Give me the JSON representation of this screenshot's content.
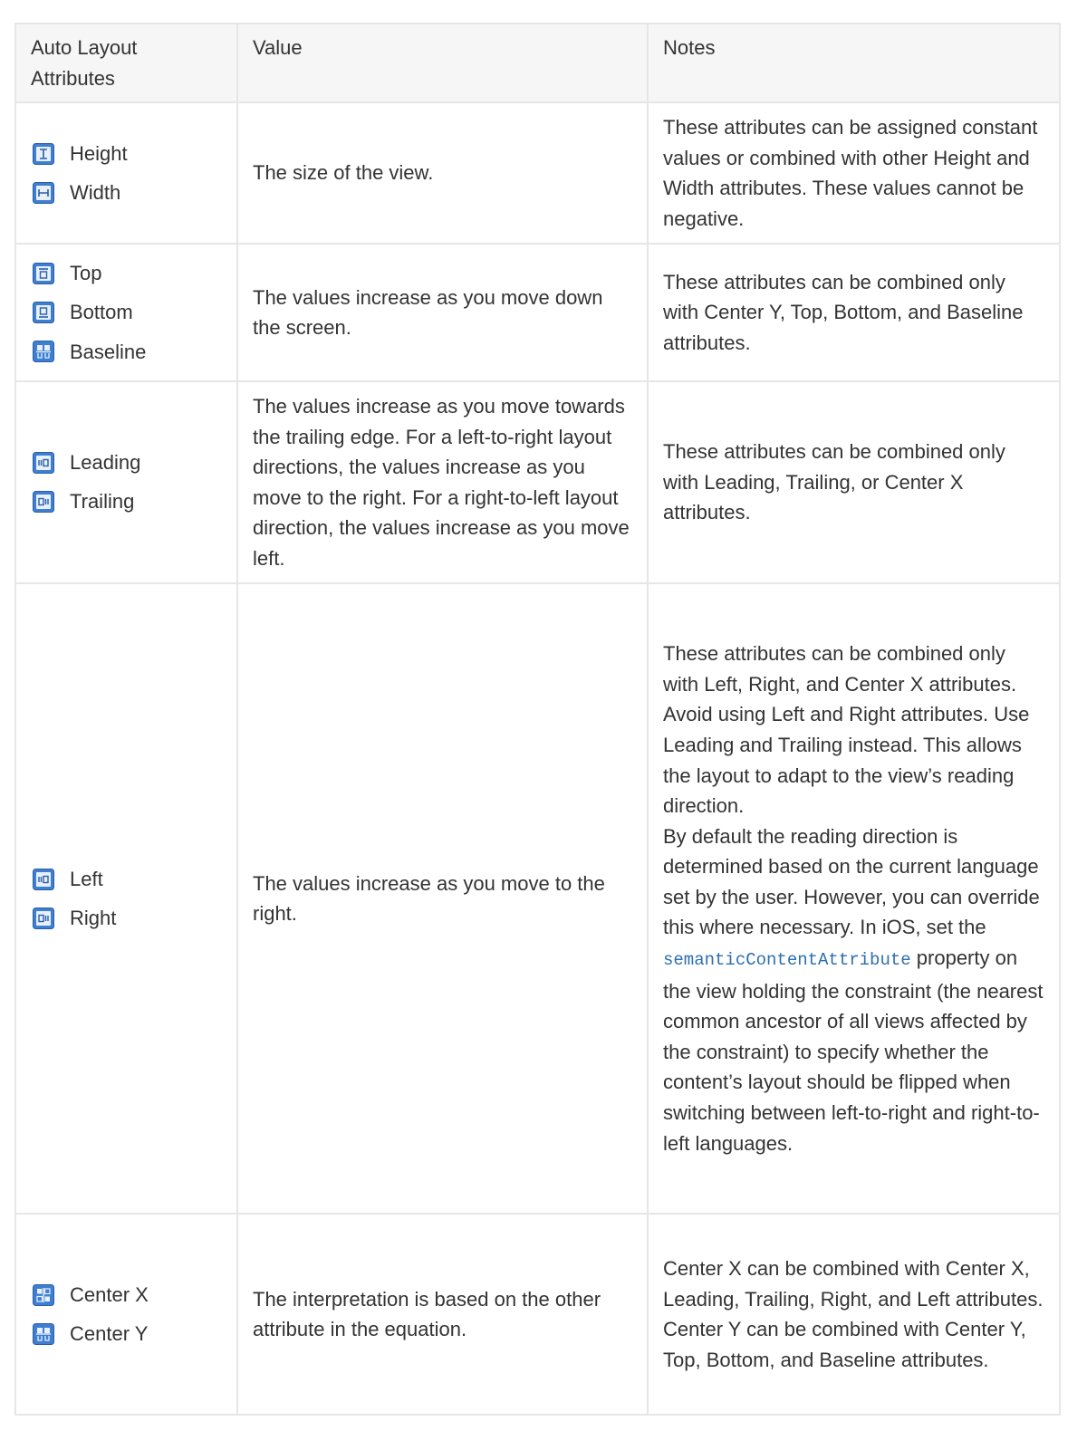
{
  "table": {
    "headers": [
      "Auto Layout Attributes",
      "Value",
      "Notes"
    ],
    "rows": [
      {
        "attributes": [
          {
            "label": "Height",
            "icon": "height-icon"
          },
          {
            "label": "Width",
            "icon": "width-icon"
          }
        ],
        "value": "The size of the view.",
        "notes": [
          "These attributes can be assigned constant values or combined with other Height and Width attributes. These values cannot be negative."
        ]
      },
      {
        "attributes": [
          {
            "label": "Top",
            "icon": "top-icon"
          },
          {
            "label": "Bottom",
            "icon": "bottom-icon"
          },
          {
            "label": "Baseline",
            "icon": "baseline-icon"
          }
        ],
        "value": "The values increase as you move down the screen.",
        "notes": [
          "These attributes can be combined only with Center Y, Top, Bottom, and Baseline attributes."
        ]
      },
      {
        "attributes": [
          {
            "label": "Leading",
            "icon": "leading-icon"
          },
          {
            "label": "Trailing",
            "icon": "trailing-icon"
          }
        ],
        "value": "The values increase as you move towards the trailing edge. For a left-to-right layout directions, the values increase as you move to the right. For a right-to-left layout direction, the values increase as you move left.",
        "notes": [
          "These attributes can be combined only with Leading, Trailing, or Center X attributes."
        ]
      },
      {
        "attributes": [
          {
            "label": "Left",
            "icon": "left-icon"
          },
          {
            "label": "Right",
            "icon": "right-icon"
          }
        ],
        "value": "The values increase as you move to the right.",
        "notes": [
          "These attributes can be combined only with Left, Right, and Center X attributes.",
          "Avoid using Left and Right attributes. Use Leading and Trailing instead. This allows the layout to adapt to the view’s reading direction.",
          "By default the reading direction is determined based on the current language set by the user. However, you can override this where necessary. In iOS, set the"
        ],
        "notes_code": "semanticContentAttribute",
        "notes_after": "property on the view holding the constraint (the nearest common ancestor of all views affected by the constraint) to specify whether the content’s layout should be flipped when switching between left-to-right and right-to-left languages."
      },
      {
        "attributes": [
          {
            "label": "Center X",
            "icon": "center-x-icon"
          },
          {
            "label": "Center Y",
            "icon": "center-y-icon"
          }
        ],
        "value": "The interpretation is based on the other attribute in the equation.",
        "notes": [
          "Center X can be combined with Center X, Leading, Trailing, Right, and Left attributes.",
          "Center Y can be combined with Center Y, Top, Bottom, and Baseline attributes."
        ]
      }
    ]
  }
}
